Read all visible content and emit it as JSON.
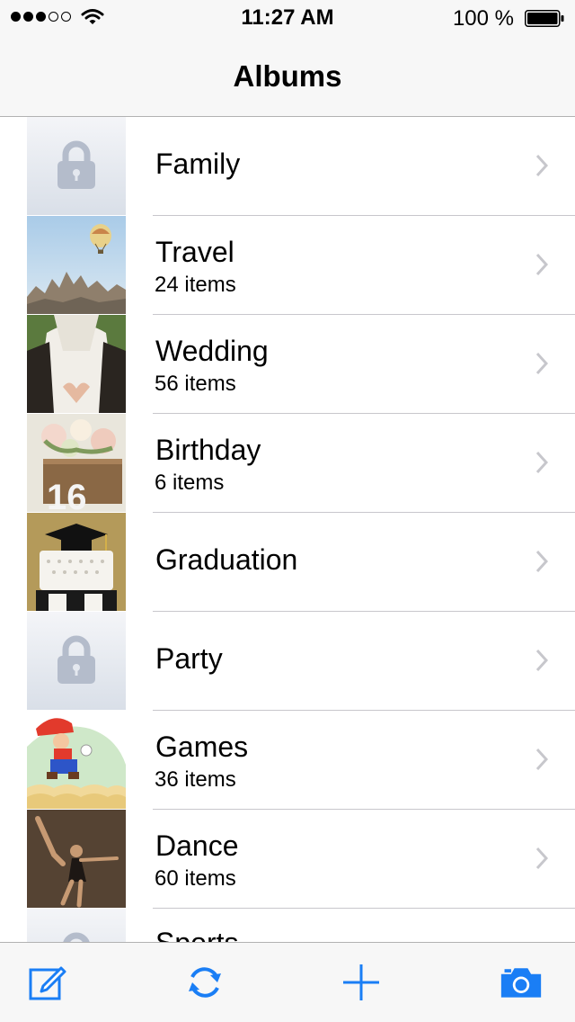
{
  "status_bar": {
    "time": "11:27 AM",
    "battery_percent": "100 %",
    "signal_bars": 3,
    "signal_max": 5
  },
  "nav": {
    "title": "Albums"
  },
  "albums": [
    {
      "name": "Family",
      "count": "",
      "thumbnail": "lock-icon"
    },
    {
      "name": "Travel",
      "count": "24 items",
      "thumbnail": "travel-photo"
    },
    {
      "name": "Wedding",
      "count": "56 items",
      "thumbnail": "wedding-photo"
    },
    {
      "name": "Birthday",
      "count": "6 items",
      "thumbnail": "birthday-photo"
    },
    {
      "name": "Graduation",
      "count": "",
      "thumbnail": "graduation-photo"
    },
    {
      "name": "Party",
      "count": "",
      "thumbnail": "lock-icon"
    },
    {
      "name": "Games",
      "count": "36 items",
      "thumbnail": "games-photo"
    },
    {
      "name": "Dance",
      "count": "60 items",
      "thumbnail": "dance-photo"
    },
    {
      "name": "Sports",
      "count": "",
      "thumbnail": "lock-icon"
    }
  ],
  "tabbar": {
    "icons": [
      "compose-icon",
      "refresh-icon",
      "add-icon",
      "camera-icon"
    ]
  },
  "colors": {
    "accent": "#1a7ef5",
    "chevron": "#c7c7cc",
    "lock": "#b4bccb"
  }
}
